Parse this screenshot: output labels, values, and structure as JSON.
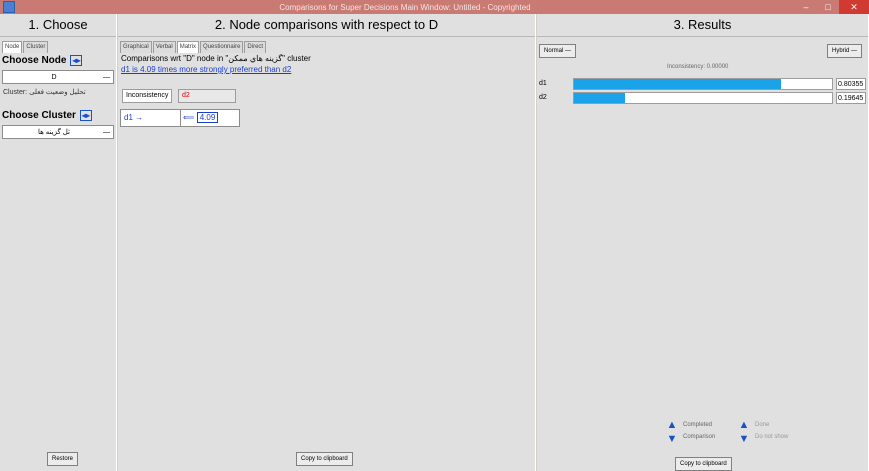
{
  "window": {
    "title": "Comparisons for Super Decisions Main Window: Untitled - Copyrighted",
    "minimize": "–",
    "maximize": "□",
    "close": "✕"
  },
  "pane1": {
    "title": "1. Choose",
    "tabs": [
      "Node",
      "Cluster"
    ],
    "choose_node_label": "Choose Node",
    "node_value": "D",
    "cluster_label_prefix": "Cluster:",
    "cluster_label_value": "تحليل وضعيت فعلی",
    "choose_cluster_label": "Choose Cluster",
    "cluster_value": "ثل گزینه ها",
    "restore_button": "Restore"
  },
  "pane2": {
    "title": "2. Node comparisons with respect to D",
    "tabs": [
      "Graphical",
      "Verbal",
      "Matrix",
      "Questionnaire",
      "Direct"
    ],
    "description_prefix": "Comparisons wrt \"D\" node in \"",
    "description_cluster": "گزينه هاي ممكن",
    "description_suffix": "\" cluster",
    "description_line2": "d1 is 4.09 times more strongly preferred than d2",
    "description_line2_red": "d2",
    "inconsistency_label": "Inconsistency",
    "inconsistency_value": "d2",
    "matrix_row_label": "d1",
    "matrix_value": "4.09",
    "copy_button": "Copy to clipboard"
  },
  "pane3": {
    "title": "3. Results",
    "normal_label": "Normal",
    "hybrid_label": "Hybrid",
    "inconsistency_text": "Inconsistency: 0.00000",
    "results": [
      {
        "name": "d1",
        "value": "0.80355",
        "fraction": 0.80355
      },
      {
        "name": "d2",
        "value": "0.19645",
        "fraction": 0.19645
      }
    ],
    "completed_label": "Completed",
    "comparison_label": "Comparison",
    "done_label": "Done",
    "do_not_show_label": "Do not show",
    "copy_button": "Copy to clipboard"
  },
  "colors": {
    "titlebar": "#c97a72",
    "bar_fill": "#1aa3e8",
    "link": "#1a3fd0"
  }
}
